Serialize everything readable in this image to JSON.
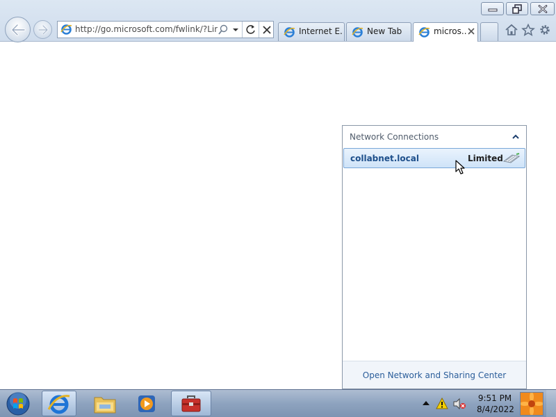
{
  "window": {
    "minimize_icon": "minimize-icon",
    "maximize_icon": "restore-icon",
    "close_icon": "close-icon"
  },
  "address_bar": {
    "url": "http://go.microsoft.com/fwlink/?LinkId=",
    "icon": "ie-icon"
  },
  "tabs": [
    {
      "label": "Internet E...",
      "icon": "ie-icon",
      "active": false
    },
    {
      "label": "New Tab",
      "icon": "ie-icon",
      "active": false
    },
    {
      "label": "micros...",
      "icon": "ie-icon",
      "active": true
    }
  ],
  "toolbar_icons": [
    "home-icon",
    "favorites-star-icon",
    "tools-gear-icon"
  ],
  "network_panel": {
    "title": "Network Connections",
    "connection": {
      "name": "collabnet.local",
      "status": "Limited"
    },
    "footer_link": "Open Network and Sharing Center"
  },
  "taskbar": {
    "pinned": [
      "internet-explorer",
      "windows-explorer",
      "media-player",
      "toolbox"
    ],
    "clock": {
      "time": "9:51 PM",
      "date": "8/4/2022"
    }
  },
  "colors": {
    "chrome_bg": "#dce7f3",
    "link": "#2a5d9a",
    "connection_name": "#1d4f8b",
    "selected_item_bg": "#cfe3f8",
    "taskbar": "#8ea3bf"
  }
}
